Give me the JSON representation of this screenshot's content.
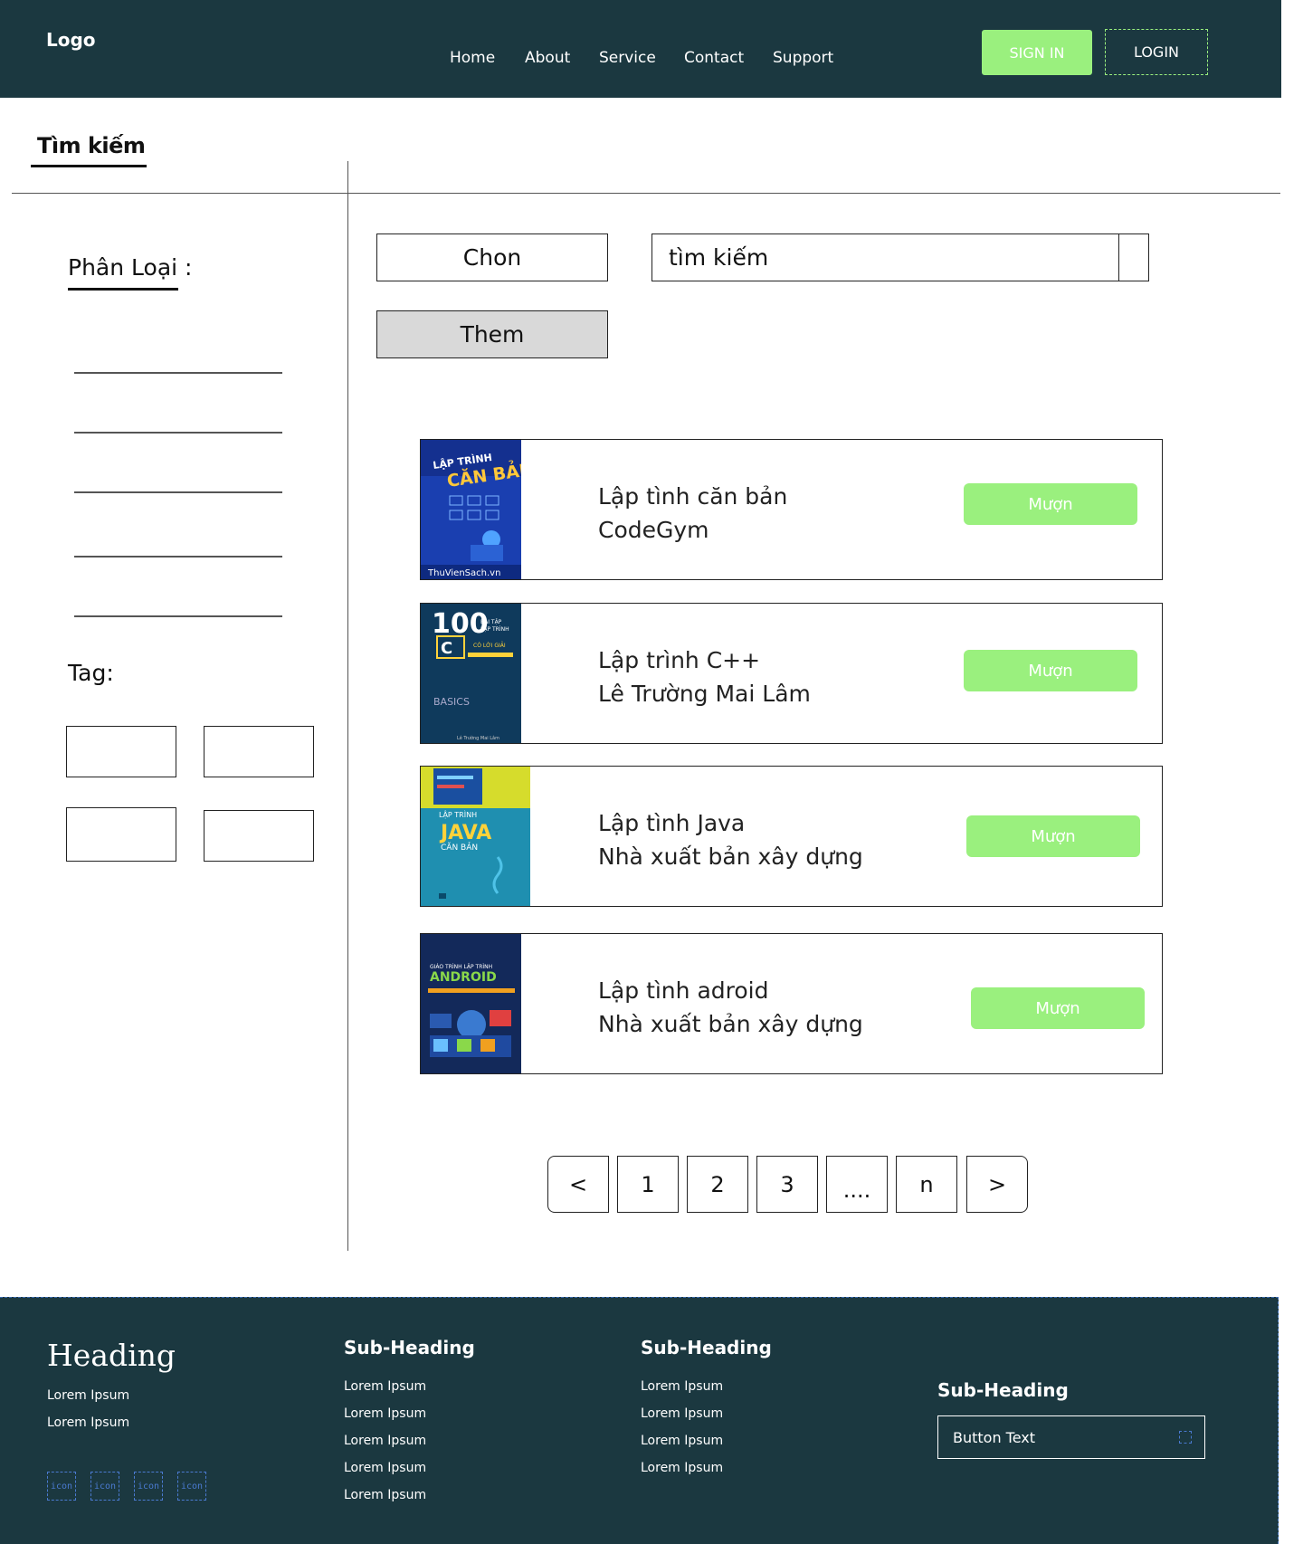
{
  "header": {
    "logo": "Logo",
    "nav": [
      "Home",
      "About",
      "Service",
      "Contact",
      "Support"
    ],
    "sign_in": "SIGN IN",
    "login": "LOGIN"
  },
  "search_tab": {
    "title": "Tìm kiếm"
  },
  "sidebar": {
    "category_label": "Phân Loại :",
    "tag_label": "Tag:"
  },
  "controls": {
    "select_label": "Chon",
    "search_placeholder": "tìm kiếm",
    "add_label": "Them"
  },
  "books": [
    {
      "title": "Lập tình căn bản",
      "author": "CodeGym",
      "button": "Mượn",
      "cover": "lap-trinh-can-ban-cover"
    },
    {
      "title": "Lập trình C++",
      "author": "Lê Trường Mai Lâm",
      "button": "Mượn",
      "cover": "100-bai-tap-cpp-cover"
    },
    {
      "title": "Lập tình Java",
      "author": "Nhà xuất bản xây dựng",
      "button": "Mượn",
      "cover": "java-can-ban-cover"
    },
    {
      "title": "Lập tình adroid",
      "author": "Nhà xuất bản xây dựng",
      "button": "Mượn",
      "cover": "android-cover"
    }
  ],
  "pagination": [
    "<",
    "1",
    "2",
    "3",
    "....",
    "n",
    ">"
  ],
  "footer": {
    "heading": "Heading",
    "col1_links": [
      "Lorem Ipsum",
      "Lorem Ipsum"
    ],
    "col2": {
      "title": "Sub-Heading",
      "links": [
        "Lorem Ipsum",
        "Lorem Ipsum",
        "Lorem Ipsum",
        "Lorem Ipsum",
        "Lorem Ipsum"
      ]
    },
    "col3": {
      "title": "Sub-Heading",
      "links": [
        "Lorem Ipsum",
        "Lorem Ipsum",
        "Lorem Ipsum",
        "Lorem Ipsum"
      ]
    },
    "col4": {
      "title": "Sub-Heading",
      "button_text": "Button Text"
    },
    "icons": [
      "icon",
      "icon",
      "icon",
      "icon"
    ]
  },
  "colors": {
    "header_bg": "#1b3840",
    "accent": "#9af07e",
    "button_gray": "#d9d9d9"
  }
}
